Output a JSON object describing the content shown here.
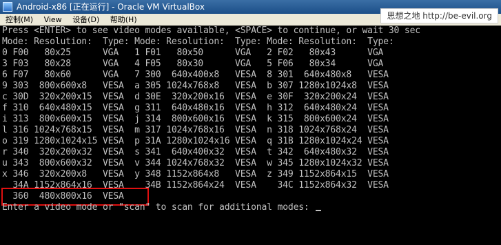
{
  "window": {
    "title": "Android-x86 [正在运行] - Oracle VM VirtualBox"
  },
  "menu": {
    "items": [
      "控制(M)",
      "View",
      "设备(D)",
      "帮助(H)"
    ]
  },
  "watermark": {
    "text": "思想之地 http://be-evil.org"
  },
  "console": {
    "lines": [
      "Press <ENTER> to see video modes available, <SPACE> to continue, or wait 30 sec",
      "Mode: Resolution:  Type: Mode: Resolution:  Type: Mode: Resolution:  Type:",
      "0 F00   80x25      VGA   1 F01   80x50      VGA   2 F02   80x43      VGA",
      "3 F03   80x28      VGA   4 F05   80x30      VGA   5 F06   80x34      VGA",
      "6 F07   80x60      VGA   7 300  640x400x8   VESA  8 301  640x480x8   VESA",
      "9 303  800x600x8   VESA  a 305 1024x768x8   VESA  b 307 1280x1024x8  VESA",
      "c 30D  320x200x15  VESA  d 30E  320x200x16  VESA  e 30F  320x200x24  VESA",
      "f 310  640x480x15  VESA  g 311  640x480x16  VESA  h 312  640x480x24  VESA",
      "i 313  800x600x15  VESA  j 314  800x600x16  VESA  k 315  800x600x24  VESA",
      "l 316 1024x768x15  VESA  m 317 1024x768x16  VESA  n 318 1024x768x24  VESA",
      "o 319 1280x1024x15 VESA  p 31A 1280x1024x16 VESA  q 31B 1280x1024x24 VESA",
      "r 340  320x200x32  VESA  s 341  640x400x32  VESA  t 342  640x480x32  VESA",
      "u 343  800x600x32  VESA  v 344 1024x768x32  VESA  w 345 1280x1024x32 VESA",
      "x 346  320x200x8   VESA  y 348 1152x864x8   VESA  z 349 1152x864x15  VESA",
      "  34A 1152x864x16  VESA    34B 1152x864x24  VESA    34C 1152x864x32  VESA",
      "  360  480x800x16  VESA",
      "Enter a video mode or \"scan\" to scan for additional modes: "
    ]
  }
}
